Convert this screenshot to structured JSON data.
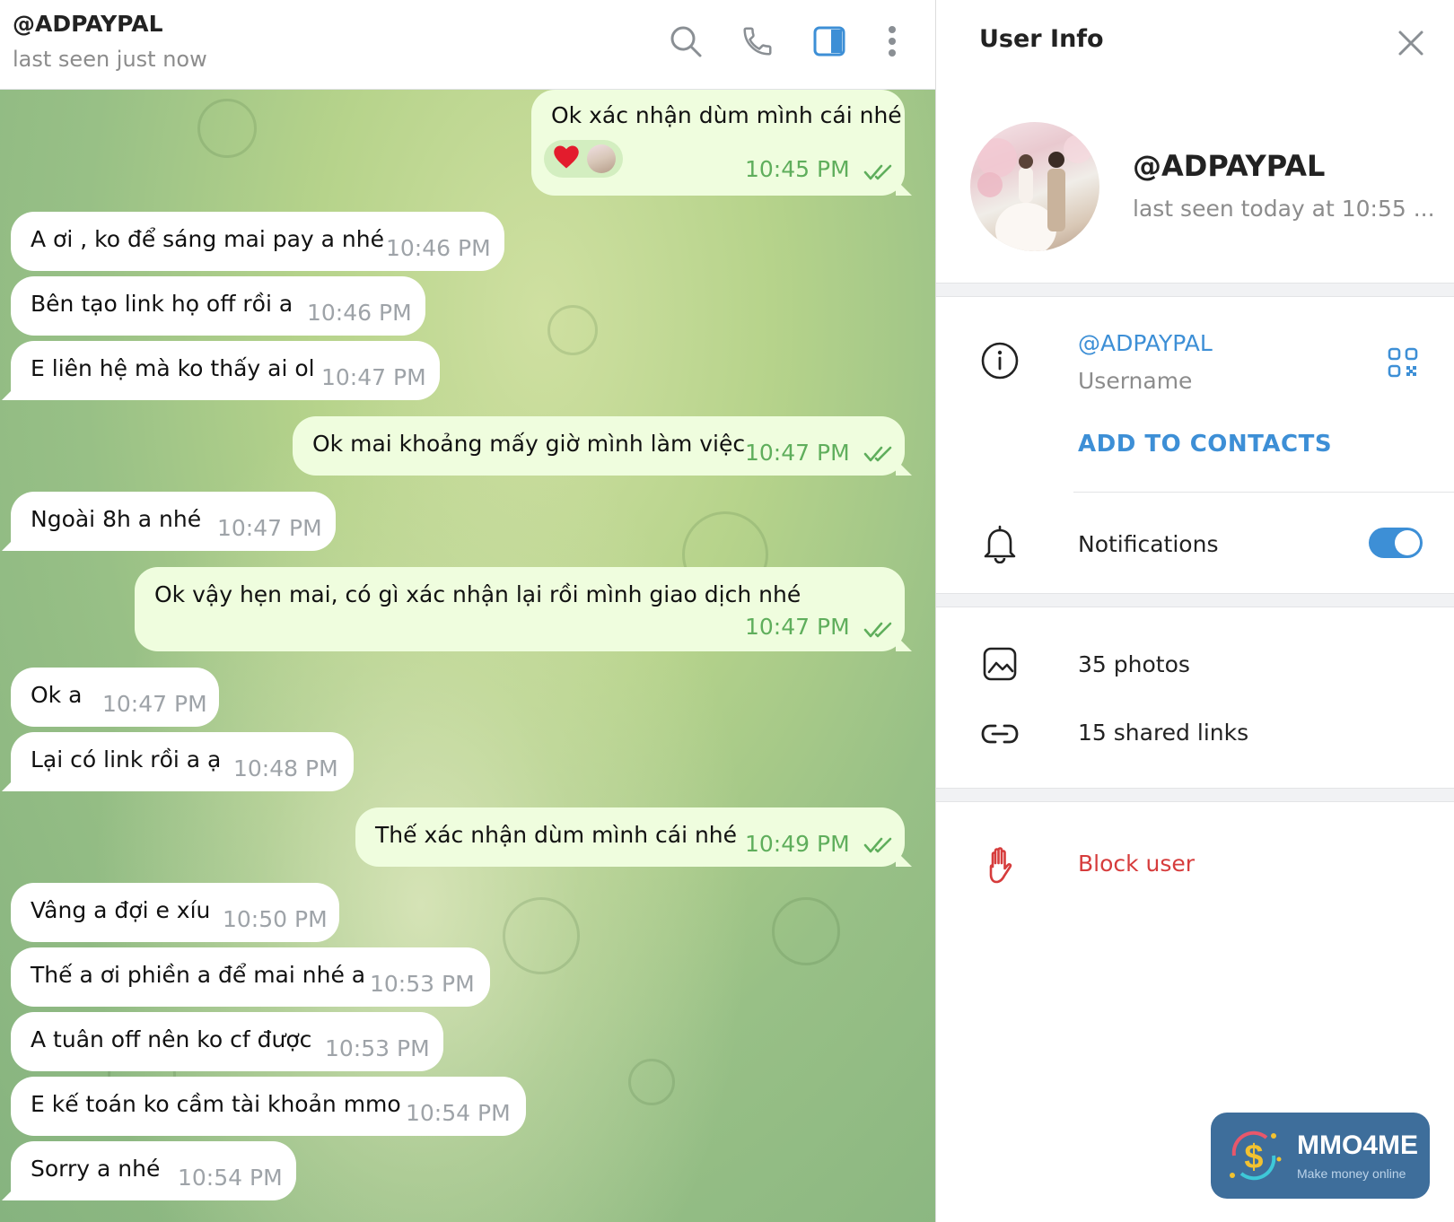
{
  "chat": {
    "title": "@ADPAYPAL",
    "status": "last seen just now",
    "icons": {
      "search": "search-icon",
      "call": "phone-icon",
      "panel": "sidebar-panel-icon",
      "more": "more-vertical-icon"
    },
    "messages": [
      {
        "dir": "out",
        "text": "Ok xác nhận dùm mình cái nhé",
        "time": "10:45 PM",
        "reaction": "heart"
      },
      {
        "dir": "in",
        "text": "A ơi , ko để sáng mai pay a nhé",
        "time": "10:46 PM"
      },
      {
        "dir": "in",
        "text": "Bên tạo link họ off rồi a",
        "time": "10:46 PM"
      },
      {
        "dir": "in",
        "text": "E liên hệ mà ko thấy ai ol",
        "time": "10:47 PM"
      },
      {
        "dir": "out",
        "text": "Ok mai khoảng mấy giờ mình làm việc",
        "time": "10:47 PM"
      },
      {
        "dir": "in",
        "text": "Ngoài 8h a nhé",
        "time": "10:47 PM"
      },
      {
        "dir": "out",
        "text": "Ok vậy hẹn mai, có gì xác nhận lại rồi mình giao dịch nhé",
        "time": "10:47 PM"
      },
      {
        "dir": "in",
        "text": "Ok a",
        "time": "10:47 PM"
      },
      {
        "dir": "in",
        "text": "Lại có link rồi a ạ",
        "time": "10:48 PM"
      },
      {
        "dir": "out",
        "text": "Thế xác nhận dùm mình cái nhé",
        "time": "10:49 PM"
      },
      {
        "dir": "in",
        "text": "Vâng a đợi e xíu",
        "time": "10:50 PM"
      },
      {
        "dir": "in",
        "text": "Thế a ơi phiền a để mai nhé a",
        "time": "10:53 PM"
      },
      {
        "dir": "in",
        "text": "A tuân off nên ko cf được",
        "time": "10:53 PM"
      },
      {
        "dir": "in",
        "text": "E kế toán ko cầm tài khoản mmo",
        "time": "10:54 PM"
      },
      {
        "dir": "in",
        "text": "Sorry a nhé",
        "time": "10:54 PM"
      }
    ]
  },
  "info": {
    "title": "User Info",
    "profile_name": "@ADPAYPAL",
    "profile_status": "last seen today at 10:55 ...",
    "username_value": "@ADPAYPAL",
    "username_label": "Username",
    "add_contacts": "ADD TO CONTACTS",
    "notifications": "Notifications",
    "notifications_on": true,
    "photos": "35 photos",
    "links": "15 shared links",
    "block": "Block user"
  },
  "watermark": {
    "title": "MMO4ME",
    "subtitle": "Make money online"
  },
  "colors": {
    "accent": "#3d8fd6",
    "outgoing_bubble": "#effdde",
    "outgoing_time": "#5fae5c",
    "danger": "#d63c3c"
  }
}
